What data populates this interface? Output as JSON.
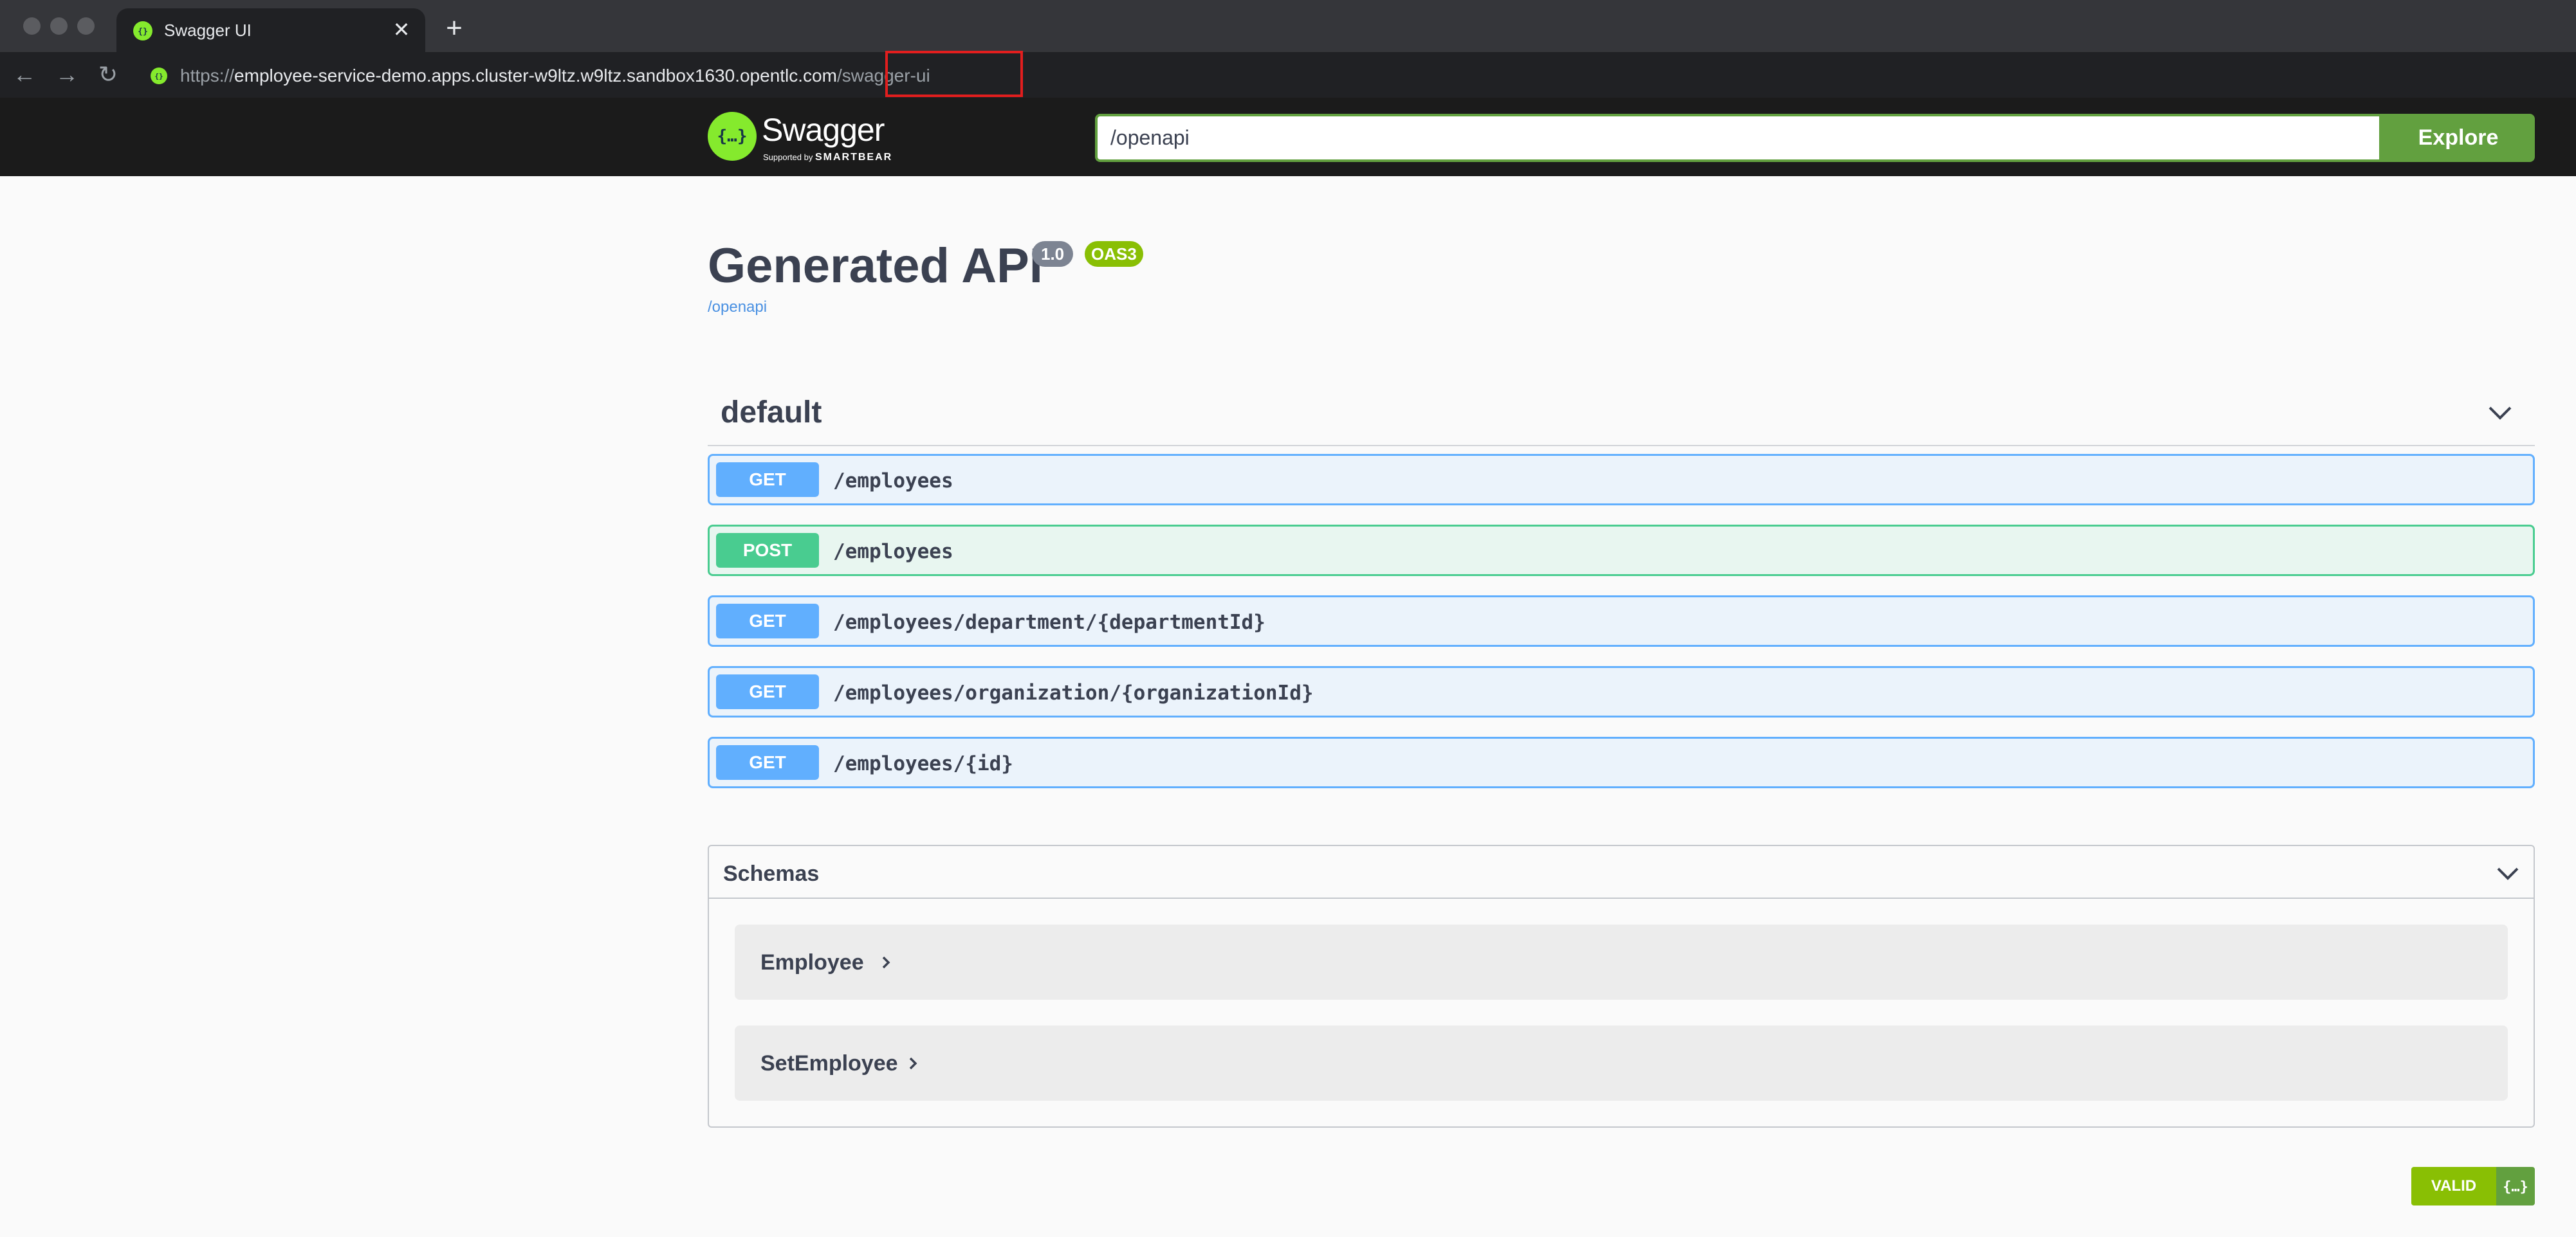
{
  "browser": {
    "tab_title": "Swagger UI",
    "tab_close": "✕",
    "new_tab": "+",
    "url_scheme": "https://",
    "url_host": "employee-service-demo.apps.cluster-w9ltz.w9ltz.sandbox1630.opentlc.com",
    "url_path": "/swagger-ui",
    "back": "←",
    "forward": "→",
    "reload": "↻",
    "highlight_color": "#e21e1e"
  },
  "topbar": {
    "brand": "Swagger",
    "tagline_prefix": "Supported by",
    "tagline_brand": "SMARTBEAR",
    "search_value": "/openapi",
    "explore_label": "Explore"
  },
  "info": {
    "title": "Generated API",
    "version": "1.0",
    "oas": "OAS3",
    "spec_link": "/openapi"
  },
  "tag": {
    "name": "default"
  },
  "operations": [
    {
      "method": "GET",
      "path": "/employees"
    },
    {
      "method": "POST",
      "path": "/employees"
    },
    {
      "method": "GET",
      "path": "/employees/department/{departmentId}"
    },
    {
      "method": "GET",
      "path": "/employees/organization/{organizationId}"
    },
    {
      "method": "GET",
      "path": "/employees/{id}"
    }
  ],
  "schemas": {
    "title": "Schemas",
    "models": [
      "Employee",
      "SetEmployee"
    ]
  },
  "validator": {
    "label": "VALID"
  },
  "colors": {
    "get": "#61affe",
    "post": "#49cc90",
    "swagger_green": "#85ea2d",
    "explore_green": "#62a03f",
    "oas_badge": "#89bf04"
  }
}
